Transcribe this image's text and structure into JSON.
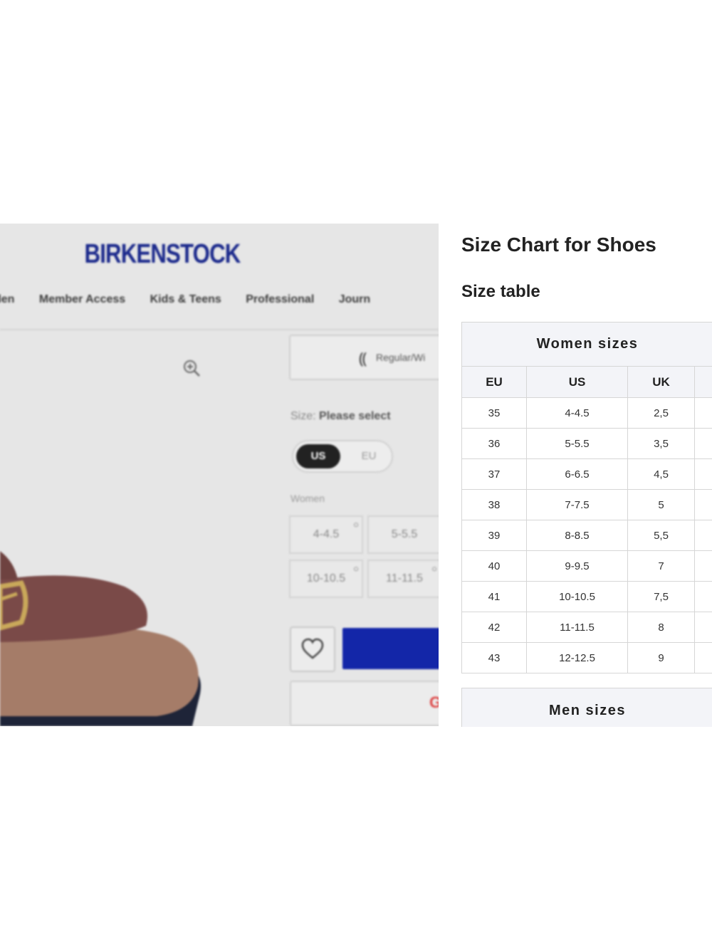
{
  "brand": {
    "logo": "BIRKENSTOCK",
    "accent_color": "#1c2a8c"
  },
  "nav": {
    "items": [
      "den",
      "Member Access",
      "Kids & Teens",
      "Professional",
      "Journ"
    ]
  },
  "product": {
    "fit_text": "Regular/Wi",
    "size_label_prefix": "Size:",
    "size_label_value": "Please select",
    "toggle": {
      "on": "US",
      "off": "EU"
    },
    "group_label": "Women",
    "size_options": [
      "4-4.5",
      "5-5.5",
      "10-10.5",
      "11-11.5"
    ],
    "icons": [
      "zoom-in-icon",
      "foot-icon",
      "heart-icon",
      "google-icon"
    ]
  },
  "size_chart": {
    "title": "Size Chart for Shoes",
    "subtitle": "Size table",
    "women": {
      "heading": "Women sizes",
      "columns": [
        "EU",
        "US",
        "UK",
        ""
      ],
      "rows": [
        [
          "35",
          "4-4.5",
          "2,5",
          ""
        ],
        [
          "36",
          "5-5.5",
          "3,5",
          ""
        ],
        [
          "37",
          "6-6.5",
          "4,5",
          ""
        ],
        [
          "38",
          "7-7.5",
          "5",
          ""
        ],
        [
          "39",
          "8-8.5",
          "5,5",
          ""
        ],
        [
          "40",
          "9-9.5",
          "7",
          ""
        ],
        [
          "41",
          "10-10.5",
          "7,5",
          ""
        ],
        [
          "42",
          "11-11.5",
          "8",
          ""
        ],
        [
          "43",
          "12-12.5",
          "9",
          ""
        ]
      ]
    },
    "men": {
      "heading": "Men sizes"
    }
  }
}
